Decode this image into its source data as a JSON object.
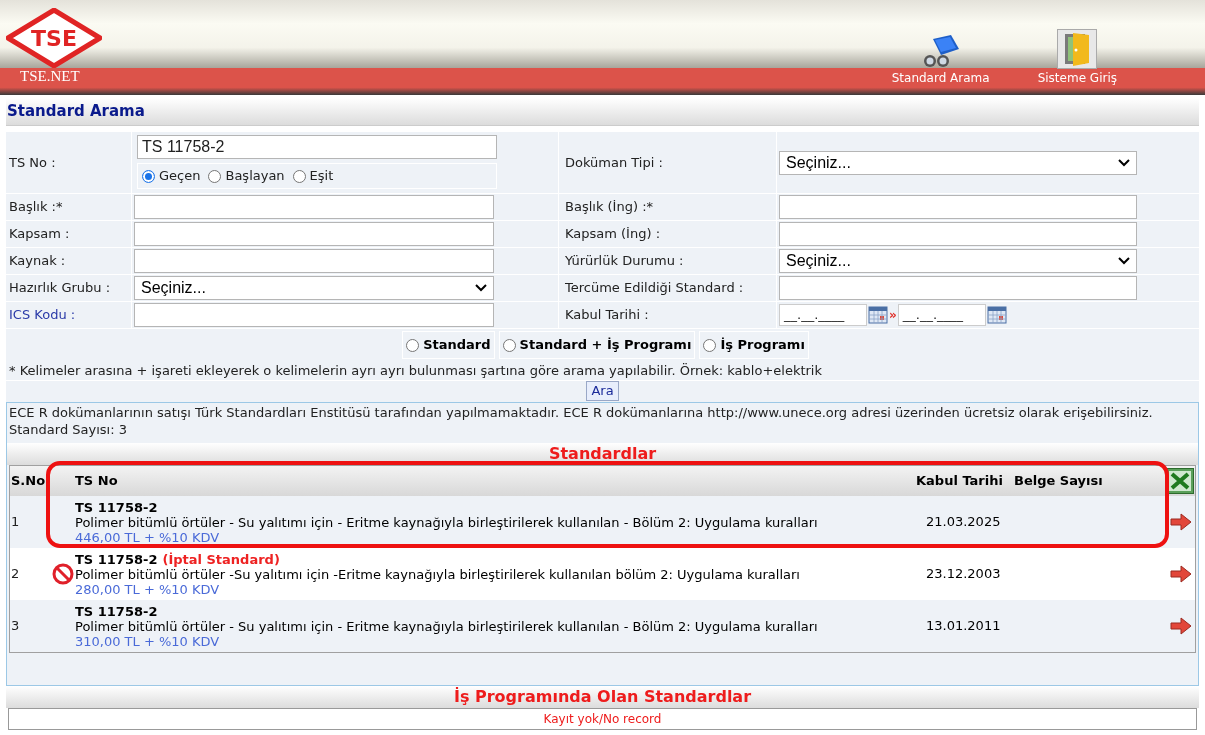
{
  "header": {
    "logo_text": "TSE",
    "site_name": "TSE.NET",
    "nav": [
      {
        "label": "Standard Arama",
        "kind": "search"
      },
      {
        "label": "Sisteme Giriş",
        "kind": "login"
      }
    ]
  },
  "page_title": "Standard Arama",
  "form": {
    "ts_no": {
      "label": "TS No :",
      "value": "TS 11758-2",
      "match": [
        {
          "label": "Geçen",
          "selected": true
        },
        {
          "label": "Başlayan",
          "selected": false
        },
        {
          "label": "Eşit",
          "selected": false
        }
      ]
    },
    "left": [
      {
        "label": "Başlık :*",
        "kind": "text",
        "link": false
      },
      {
        "label": "Kapsam :",
        "kind": "text",
        "link": false
      },
      {
        "label": "Kaynak :",
        "kind": "text",
        "link": false
      },
      {
        "label": "Hazırlık Grubu :",
        "kind": "select",
        "value": "Seçiniz...",
        "link": false
      },
      {
        "label": "ICS Kodu :",
        "kind": "text",
        "link": true
      }
    ],
    "right": [
      {
        "label": "Doküman Tipi :",
        "kind": "select",
        "value": "Seçiniz..."
      },
      {
        "label": "Başlık (İng) :*",
        "kind": "text"
      },
      {
        "label": "Kapsam (İng) :",
        "kind": "text"
      },
      {
        "label": "Yürürlük Durumu :",
        "kind": "select",
        "value": "Seçiniz..."
      },
      {
        "label": "Tercüme Edildiği Standard :",
        "kind": "text"
      },
      {
        "label": "Kabul Tarihi :",
        "kind": "date_range",
        "from": "__.__.____",
        "to": "__.__.____",
        "separator": "»"
      }
    ],
    "scope": [
      {
        "label": "Standard",
        "selected": false
      },
      {
        "label": "Standard + İş Programı",
        "selected": false
      },
      {
        "label": "İş Programı",
        "selected": false
      }
    ],
    "note": "* Kelimeler arasına + işareti ekleyerek o kelimelerin ayrı ayrı bulunması şartına göre arama yapılabilir. Örnek: kablo+elektrik",
    "search_button": "Ara"
  },
  "results": {
    "notice": "ECE R dokümanlarının satışı Türk Standardları Enstitüsü tarafından yapılmamaktadır. ECE R dokümanlarına http://www.unece.org adresi üzerinden ücretsiz olarak erişebilirsiniz.",
    "count": "Standard Sayısı: 3",
    "title": "Standardlar",
    "columns": [
      "S.No",
      "TS No",
      "Kabul Tarihi",
      "Belge Sayısı"
    ],
    "rows": [
      {
        "no": "1",
        "ts_no": "TS 11758-2",
        "cancelled": false,
        "highlighted": true,
        "title": "Polimer bitümlü örtüler - Su yalıtımı için - Eritme kaynağıyla birleştirilerek kullanılan - Bölüm 2: Uygulama kuralları",
        "price": "446,00 TL + %10 KDV",
        "date": "21.03.2025"
      },
      {
        "no": "2",
        "ts_no": "TS 11758-2",
        "cancelled": true,
        "cancel_label": "(İptal Standard)",
        "highlighted": false,
        "title": "Polimer bitümlü örtüler -Su yalıtımı için -Eritme kaynağıyla birleştirilerek kullanılan bölüm 2: Uygulama kuralları",
        "price": "280,00 TL + %10 KDV",
        "date": "23.12.2003"
      },
      {
        "no": "3",
        "ts_no": "TS 11758-2",
        "cancelled": false,
        "highlighted": false,
        "title": "Polimer bitümlü örtüler - Su yalıtımı için - Eritme kaynağıyla birleştirilerek kullanılan - Bölüm 2: Uygulama kuralları",
        "price": "310,00 TL + %10 KDV",
        "date": "13.01.2011"
      }
    ]
  },
  "work_program": {
    "title": "İş Programında Olan Standardlar",
    "empty": "Kayıt yok/No record"
  }
}
